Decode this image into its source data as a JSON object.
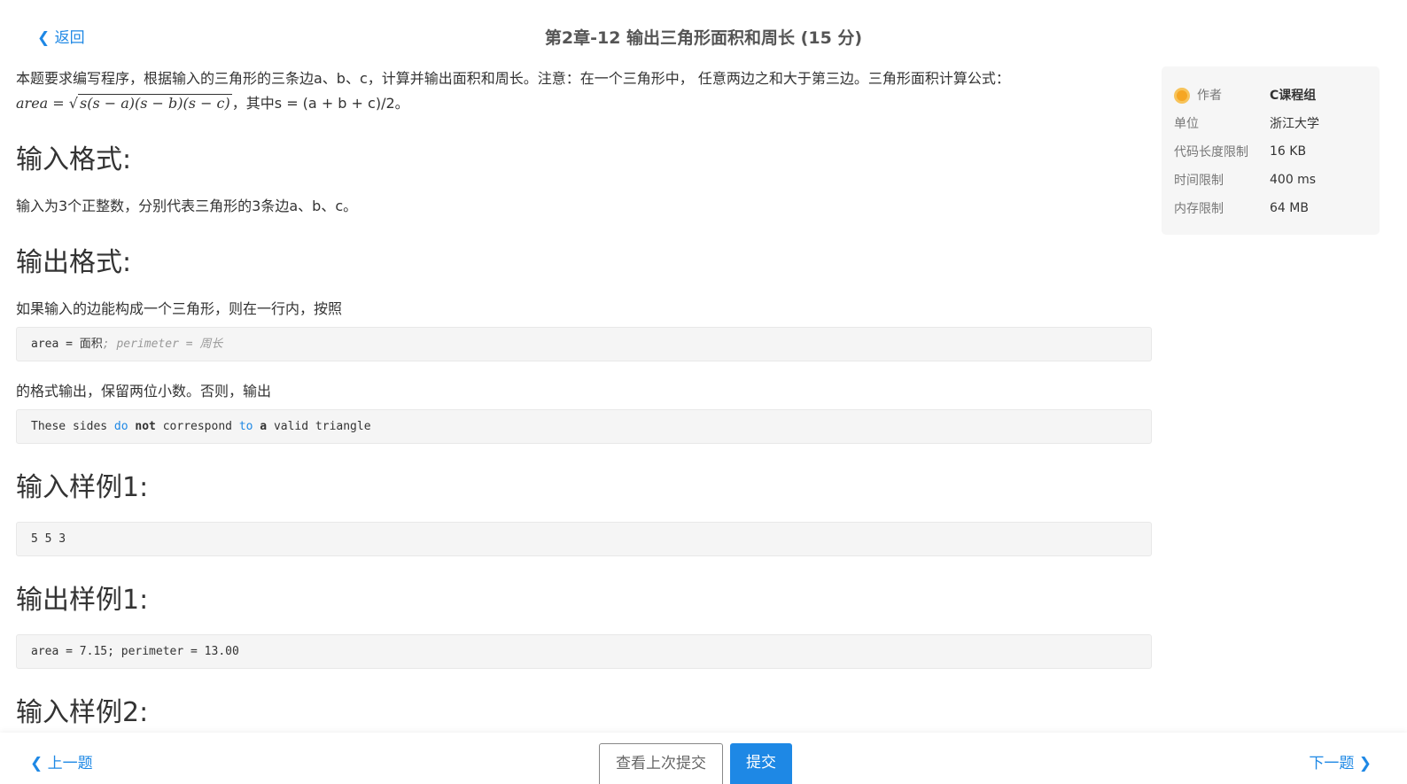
{
  "header": {
    "back": "❮ 返回",
    "title": "第2章-12 输出三角形面积和周长 (15 分)"
  },
  "problem": {
    "intro": "本题要求编写程序，根据输入的三角形的三条边a、b、c，计算并输出面积和周长。注意：在一个三角形中， 任意两边之和大于第三边。三角形面积计算公式：",
    "formula_lhs": "area = ",
    "formula_sqrt": "s(s − a)(s − b)(s − c)",
    "formula_rest": "，其中s = (a + b + c)/2。",
    "input_heading": "输入格式:",
    "input_text": "输入为3个正整数，分别代表三角形的3条边a、b、c。",
    "output_heading": "输出格式:",
    "output_text1": "如果输入的边能构成一个三角形，则在一行内，按照",
    "output_code_a": "area = 面积",
    "output_code_b": "; perimeter = 周长",
    "output_text2": "的格式输出，保留两位小数。否则，输出",
    "invalid_code": [
      "These sides ",
      "do",
      " ",
      "not",
      " correspond ",
      "to",
      " ",
      "a",
      " valid triangle"
    ],
    "sample_in1_heading": "输入样例1:",
    "sample_in1": "5 5 3",
    "sample_out1_heading": "输出样例1:",
    "sample_out1": "area = 7.15; perimeter = 13.00",
    "sample_in2_heading": "输入样例2:"
  },
  "info": [
    {
      "k": "作者",
      "v": "C课程组"
    },
    {
      "k": "单位",
      "v": "浙江大学"
    },
    {
      "k": "代码长度限制",
      "v": "16 KB"
    },
    {
      "k": "时间限制",
      "v": "400 ms"
    },
    {
      "k": "内存限制",
      "v": "64 MB"
    }
  ],
  "footer": {
    "prev": "❮ 上一题",
    "next": "下一题 ❯",
    "view_last": "查看上次提交",
    "submit": "提交"
  }
}
